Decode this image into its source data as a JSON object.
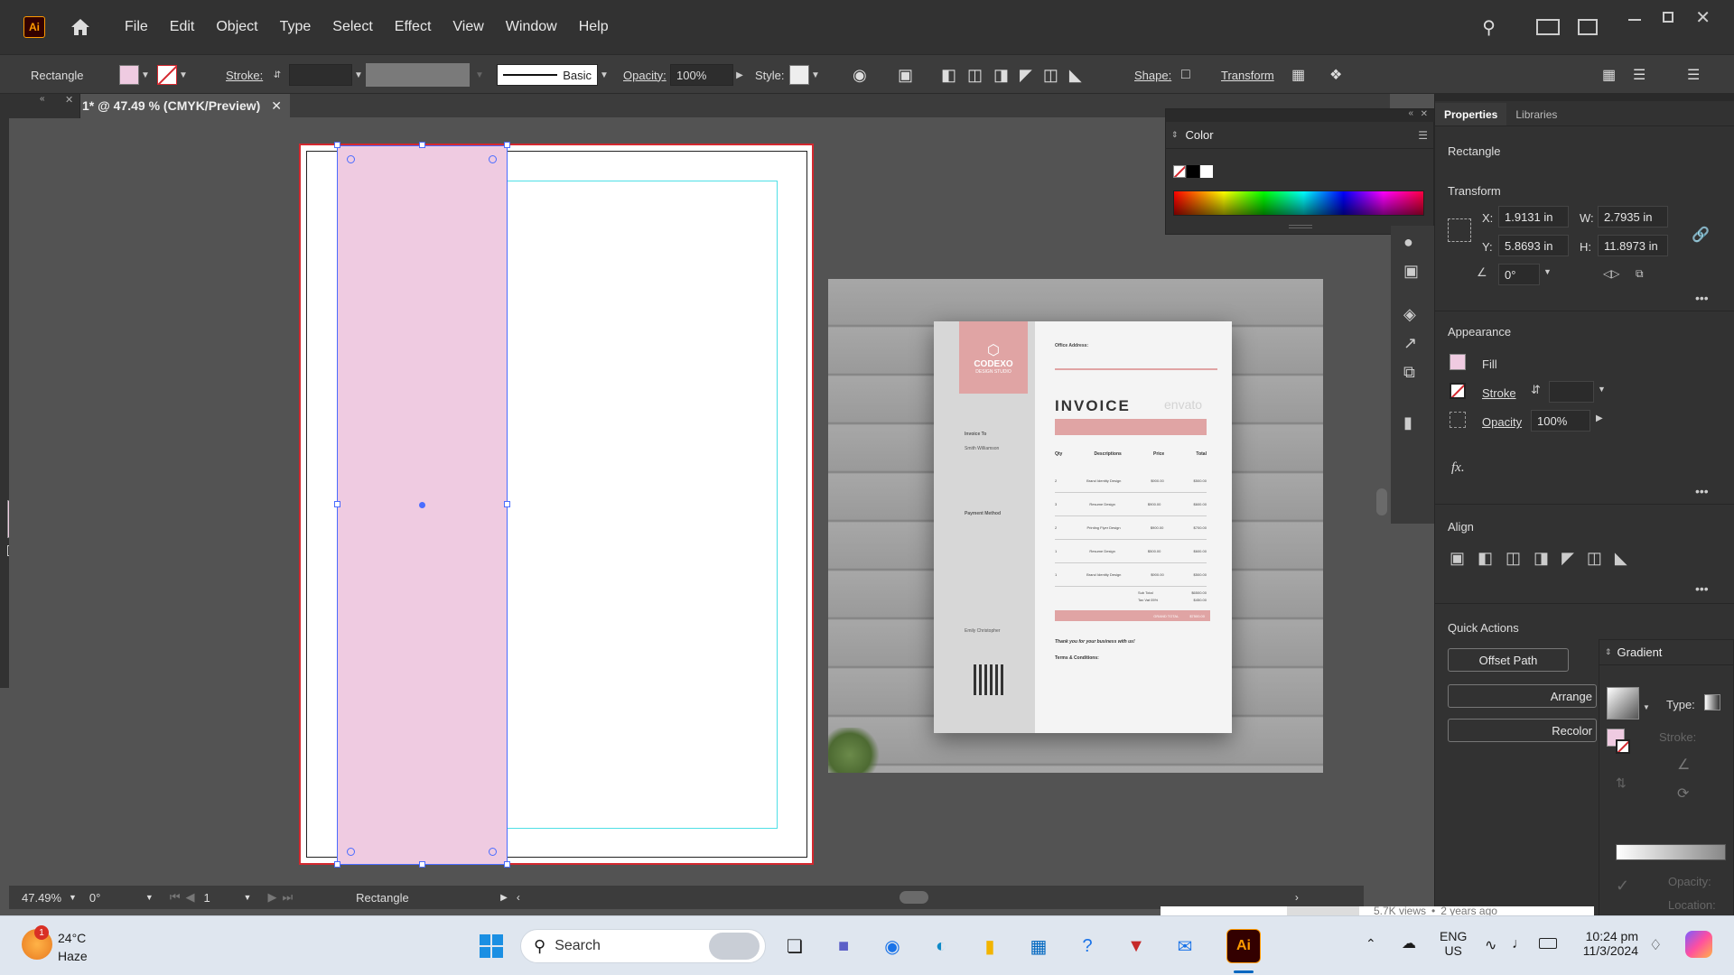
{
  "app": {
    "logo": "Ai",
    "menus": [
      "File",
      "Edit",
      "Object",
      "Type",
      "Select",
      "Effect",
      "View",
      "Window",
      "Help"
    ]
  },
  "control_bar": {
    "object_type": "Rectangle",
    "stroke_label": "Stroke:",
    "brush_label": "Basic",
    "opacity_label": "Opacity:",
    "opacity_value": "100%",
    "style_label": "Style:",
    "shape_label": "Shape:",
    "transform_label": "Transform",
    "fill_color": "#efcbe1"
  },
  "document": {
    "tab_title": "1* @ 47.49 % (CMYK/Preview)"
  },
  "status_bar": {
    "zoom": "47.49%",
    "rotation": "0°",
    "artboard_number": "1",
    "tool_status": "Rectangle"
  },
  "color_panel": {
    "title": "Color"
  },
  "properties": {
    "tabs": [
      "Properties",
      "Libraries"
    ],
    "object_type": "Rectangle",
    "transform_title": "Transform",
    "x_label": "X:",
    "x_value": "1.9131 in",
    "y_label": "Y:",
    "y_value": "5.8693 in",
    "w_label": "W:",
    "w_value": "2.7935 in",
    "h_label": "H:",
    "h_value": "11.8973 in",
    "angle_value": "0°",
    "appearance_title": "Appearance",
    "fill_label": "Fill",
    "stroke_label": "Stroke",
    "opacity_label": "Opacity",
    "opacity_value": "100%",
    "fx_label": "fx.",
    "align_title": "Align",
    "quick_actions_title": "Quick Actions",
    "offset_path_label": "Offset Path",
    "arrange_label": "Arrange",
    "recolor_label": "Recolor"
  },
  "gradient_panel": {
    "title": "Gradient",
    "type_label": "Type:",
    "stroke_label": "Stroke:",
    "opacity_label": "Opacity:",
    "location_label": "Location:"
  },
  "invoice_image": {
    "brand": "CODEXO",
    "brand_sub": "DESIGN STUDIO",
    "heading": "INVOICE",
    "office_address_label": "Office Address:",
    "invoice_to_label": "Invoice To",
    "client_name": "Smith Williamson",
    "payment_method_label": "Payment Method",
    "columns": [
      "Qty",
      "Descriptions",
      "Price",
      "Total"
    ],
    "rows": [
      [
        "2",
        "Brand Identity Design",
        "$900.00",
        "$500.00"
      ],
      [
        "3",
        "Resume Design",
        "$900.00",
        "$600.00"
      ],
      [
        "2",
        "Printing Flyer Design",
        "$900.00",
        "$700.00"
      ],
      [
        "1",
        "Resume Design",
        "$500.00",
        "$600.00"
      ],
      [
        "1",
        "Brand Identity Design",
        "$900.00",
        "$500.00"
      ]
    ],
    "sub_total_label": "Sub Total",
    "sub_total_value": "$6500.00",
    "tax_label": "Tax Vat 05%",
    "tax_value": "$450.00",
    "grand_total_label": "GRAND TOTAL",
    "grand_total_value": "$7500.00",
    "thanks": "Thank you for your business with us!",
    "terms_label": "Terms & Conditions:",
    "signer": "Emily Christopher",
    "watermark": "envato"
  },
  "background_text": {
    "views": "5.7K views",
    "dot": "•",
    "age": "2 years ago"
  },
  "taskbar": {
    "weather_temp": "24°C",
    "weather_desc": "Haze",
    "weather_badge": "1",
    "search_placeholder": "Search",
    "language_1": "ENG",
    "language_2": "US",
    "time": "10:24 pm",
    "date": "11/3/2024"
  }
}
